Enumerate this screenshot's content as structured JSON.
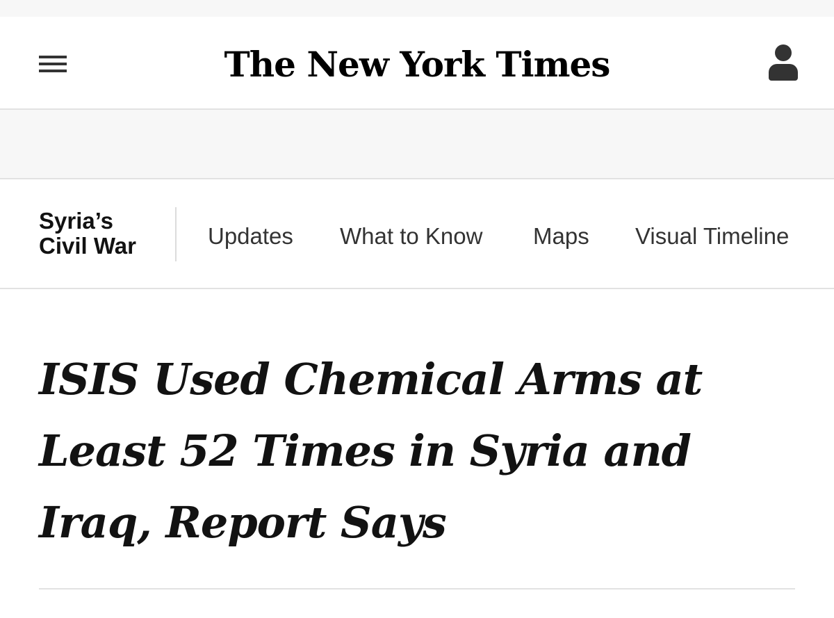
{
  "masthead": {
    "logo_text": "The New York Times",
    "menu_icon": "hamburger-menu-icon",
    "account_icon": "account-person-icon"
  },
  "section_nav": {
    "title": "Syria’s\nCivil War",
    "items": [
      {
        "label": "Updates"
      },
      {
        "label": "What to Know"
      },
      {
        "label": "Maps"
      },
      {
        "label": "Visual Timeline"
      }
    ]
  },
  "article": {
    "headline": "ISIS Used Chemical Arms at Least 52 Times in Syria and Iraq, Report Says"
  },
  "colors": {
    "text": "#121212",
    "rule": "#e2e2e2",
    "ad_background": "#f7f7f7"
  }
}
